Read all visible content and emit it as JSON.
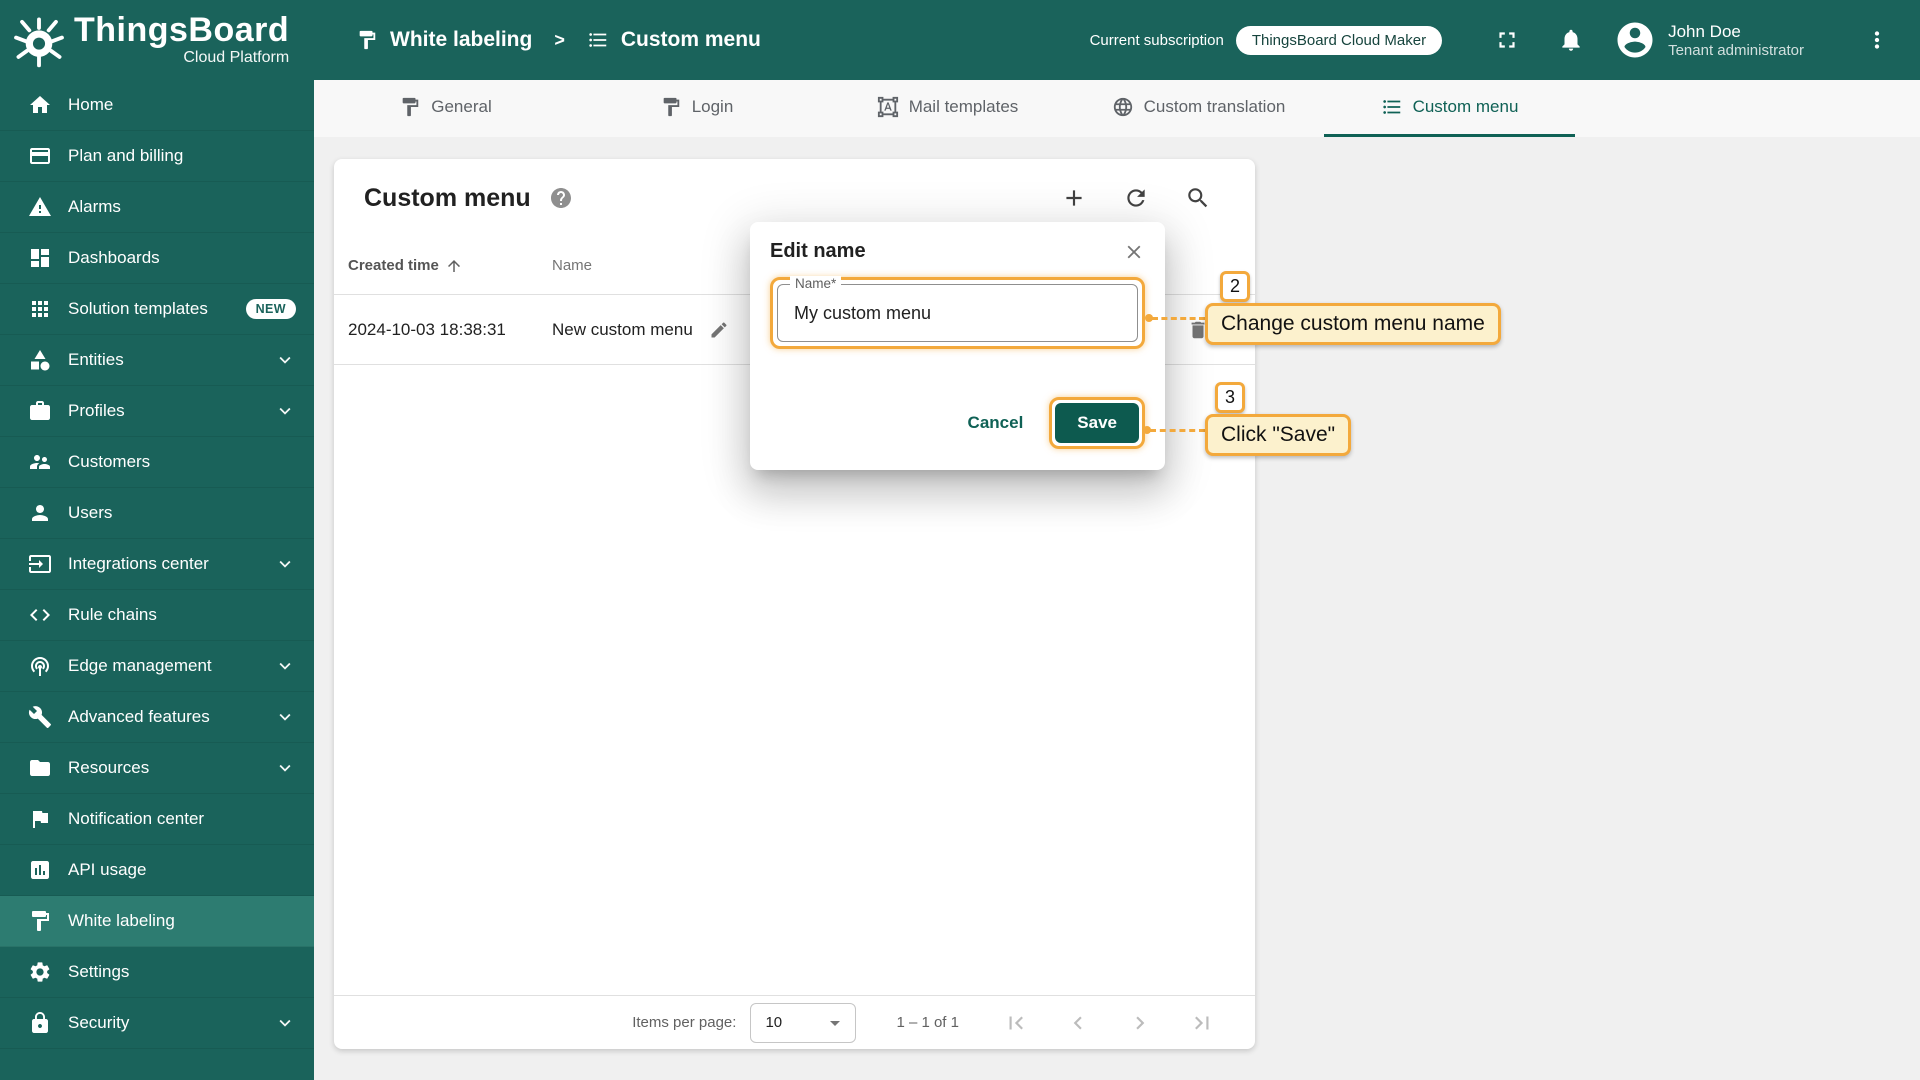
{
  "app": {
    "title": "ThingsBoard",
    "subtitle": "Cloud Platform"
  },
  "topbar": {
    "breadcrumb": {
      "parent": "White labeling",
      "separator": ">",
      "current": "Custom menu"
    },
    "subscription": {
      "label": "Current subscription",
      "plan": "ThingsBoard Cloud Maker"
    },
    "user": {
      "name": "John Doe",
      "role": "Tenant administrator"
    }
  },
  "sidebar": {
    "items": [
      {
        "label": "Home"
      },
      {
        "label": "Plan and billing"
      },
      {
        "label": "Alarms"
      },
      {
        "label": "Dashboards"
      },
      {
        "label": "Solution templates",
        "badge": "NEW"
      },
      {
        "label": "Entities",
        "expandable": true
      },
      {
        "label": "Profiles",
        "expandable": true
      },
      {
        "label": "Customers"
      },
      {
        "label": "Users"
      },
      {
        "label": "Integrations center",
        "expandable": true
      },
      {
        "label": "Rule chains"
      },
      {
        "label": "Edge management",
        "expandable": true
      },
      {
        "label": "Advanced features",
        "expandable": true
      },
      {
        "label": "Resources",
        "expandable": true
      },
      {
        "label": "Notification center"
      },
      {
        "label": "API usage"
      },
      {
        "label": "White labeling",
        "active": true
      },
      {
        "label": "Settings"
      },
      {
        "label": "Security",
        "expandable": true
      }
    ]
  },
  "tabs": [
    {
      "label": "General"
    },
    {
      "label": "Login"
    },
    {
      "label": "Mail templates"
    },
    {
      "label": "Custom translation"
    },
    {
      "label": "Custom menu",
      "active": true
    }
  ],
  "page": {
    "title": "Custom menu",
    "table": {
      "col_created": "Created time",
      "col_name": "Name",
      "rows": [
        {
          "created": "2024-10-03 18:38:31",
          "name": "New custom menu"
        }
      ]
    },
    "pagination": {
      "items_per_page_label": "Items per page:",
      "page_size": "10",
      "range": "1 – 1 of 1"
    }
  },
  "dialog": {
    "title": "Edit name",
    "name_label": "Name*",
    "name_value": "My custom menu",
    "cancel": "Cancel",
    "save": "Save"
  },
  "annotations": {
    "step2": {
      "number": "2",
      "text": "Change custom menu name"
    },
    "step3": {
      "number": "3",
      "text": "Click \"Save\""
    }
  },
  "colors": {
    "primary": "#1a635b",
    "primary_active": "#2d7c71",
    "accent": "#0f6155",
    "annotation": "#f3a93c"
  }
}
